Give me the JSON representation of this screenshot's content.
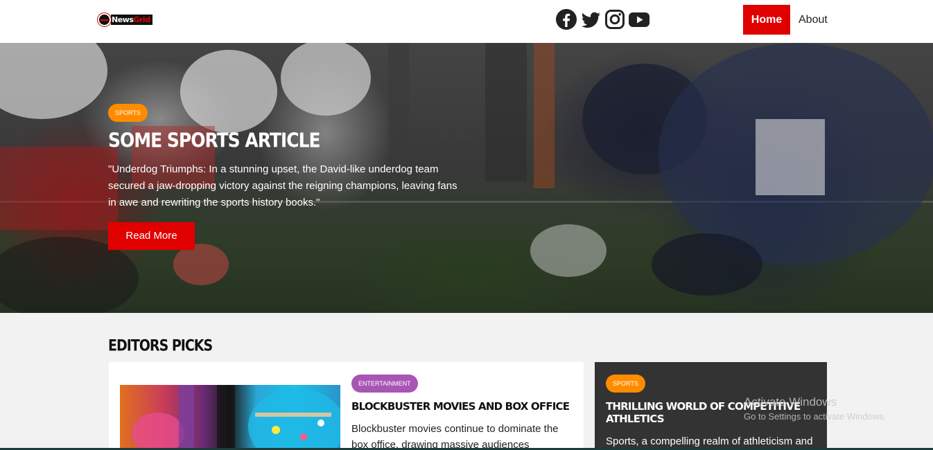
{
  "navbar": {
    "logo": {
      "part1": "News",
      "part2": "Grid"
    },
    "socials": [
      {
        "icon": "facebook-icon"
      },
      {
        "icon": "twitter-icon"
      },
      {
        "icon": "instagram-icon"
      },
      {
        "icon": "youtube-icon"
      }
    ],
    "links": {
      "home": "Home",
      "about": "About"
    }
  },
  "hero": {
    "category": "SPORTS",
    "title": "SOME SPORTS ARTICLE",
    "description": "\"Underdog Triumphs: In a stunning upset, the David-like underdog team secured a jaw-dropping victory against the reigning champions, leaving fans in awe and rewriting the sports history books.\"",
    "button": "Read More"
  },
  "editors_picks": {
    "heading": "EDITORS PICKS",
    "main_card": {
      "category": "ENTERTAINMENT",
      "title": "BLOCKBUSTER MOVIES AND BOX OFFICE",
      "text": "Blockbuster movies continue to dominate the box office, drawing massive audiences"
    },
    "side_card": {
      "category": "SPORTS",
      "title": "THRILLING WORLD OF COMPETITIVE ATHLETICS",
      "text": "Sports, a compelling realm of athleticism and competition, unites people worldwide"
    }
  },
  "watermark": {
    "title": "Activate Windows",
    "subtitle": "Go to Settings to activate Windows."
  },
  "colors": {
    "accent": "#e00000",
    "sports_badge": "#ff8c00",
    "entertainment_badge": "#a855b5",
    "dark_card": "#333333"
  }
}
